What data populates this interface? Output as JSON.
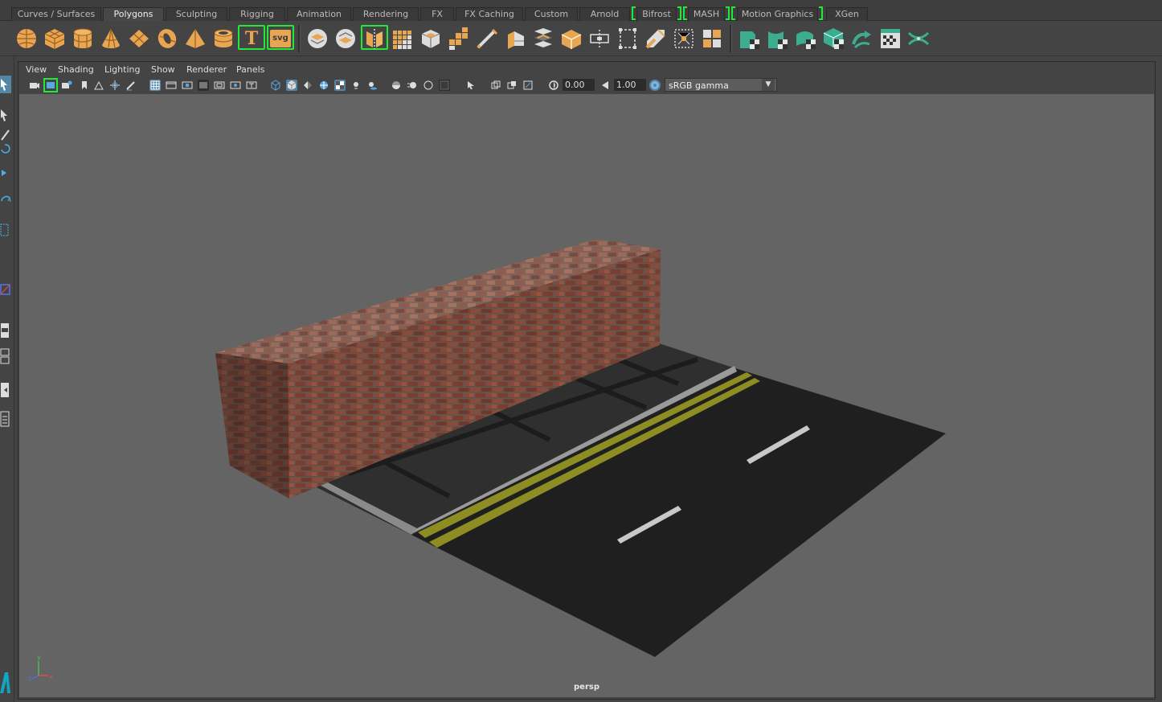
{
  "shelf": {
    "tabs": [
      "Curves / Surfaces",
      "Polygons",
      "Sculpting",
      "Rigging",
      "Animation",
      "Rendering",
      "FX",
      "FX Caching",
      "Custom",
      "Arnold",
      "Bifrost",
      "MASH",
      "Motion Graphics",
      "XGen"
    ],
    "active_tab": "Polygons",
    "text_tool_label": "T",
    "svg_tool_label": "svg",
    "icons_polygon": [
      "poly-sphere-icon",
      "poly-cube-icon",
      "poly-cylinder-icon",
      "poly-cone-icon",
      "poly-plane-icon",
      "poly-torus-icon",
      "poly-pyramid-icon",
      "poly-pipe-icon",
      "type-text-icon",
      "svg-icon",
      "combine-icon",
      "separate-icon",
      "mirror-icon",
      "smooth-icon",
      "extrude-icon",
      "bridge-icon",
      "bevel-icon",
      "multi-cut-icon",
      "target-weld-icon",
      "append-poly-icon",
      "fill-hole-icon",
      "quad-draw-icon",
      "uv-editor-icon",
      "planar-uv-icon",
      "automatic-uv-icon",
      "cut-uv-icon",
      "sew-uv-icon",
      "unfold-uv-icon",
      "layout-uv-icon",
      "checker-map-icon",
      "distribute-uv-icon"
    ],
    "accent_color": "#e8a552",
    "uv_color": "#3cae8f",
    "bracket_color": "#22e83a"
  },
  "panel_menu": [
    "View",
    "Shading",
    "Lighting",
    "Show",
    "Renderer",
    "Panels"
  ],
  "panel_toolbar": {
    "exposure": "0.00",
    "gamma": "1.00",
    "color_space": "sRGB gamma"
  },
  "viewport": {
    "camera": "persp",
    "background": "#646464",
    "axis_labels": [
      "x",
      "y",
      "z"
    ]
  }
}
